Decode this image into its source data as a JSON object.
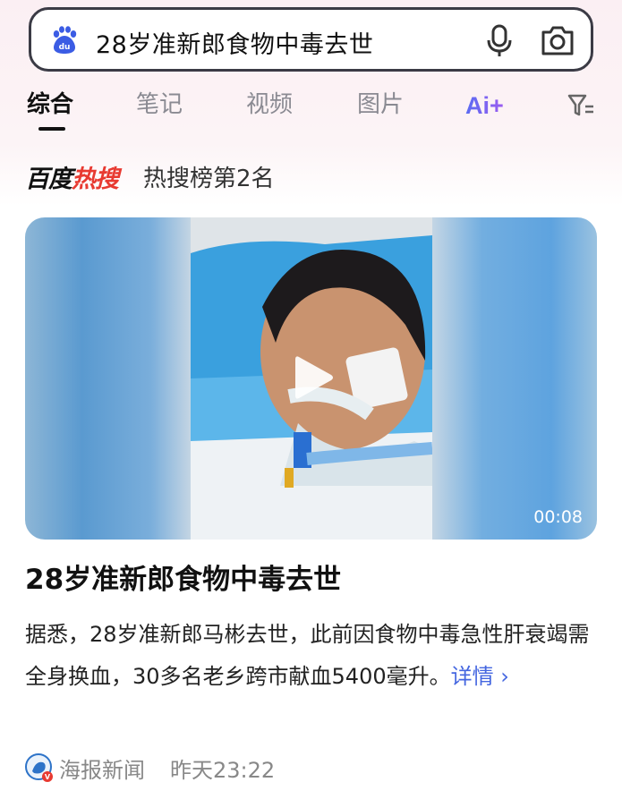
{
  "search": {
    "query": "28岁准新郎食物中毒去世",
    "logo_icon": "baidu-paw-icon",
    "mic_icon": "microphone-icon",
    "camera_icon": "camera-icon"
  },
  "tabs": [
    {
      "label": "综合",
      "active": true
    },
    {
      "label": "笔记",
      "active": false
    },
    {
      "label": "视频",
      "active": false
    },
    {
      "label": "图片",
      "active": false
    }
  ],
  "ai_tab": {
    "label": "Ai+"
  },
  "filter_icon": "filter-icon",
  "hot": {
    "logo_black": "百度",
    "logo_red": "热搜",
    "rank": "热搜榜第2名"
  },
  "video": {
    "duration": "00:08",
    "play_icon": "play-icon"
  },
  "article": {
    "headline": "28岁准新郎食物中毒去世",
    "summary": "据悉，28岁准新郎马彬去世，此前因食物中毒急性肝衰竭需全身换血，30多名老乡跨市献血5400毫升。",
    "more_label": "详情 ›"
  },
  "source": {
    "name": "海报新闻",
    "time": "昨天23:22"
  },
  "colors": {
    "accent_red": "#e83a31",
    "link_blue": "#4466e0",
    "ai_blue": "#4f6cf0"
  }
}
